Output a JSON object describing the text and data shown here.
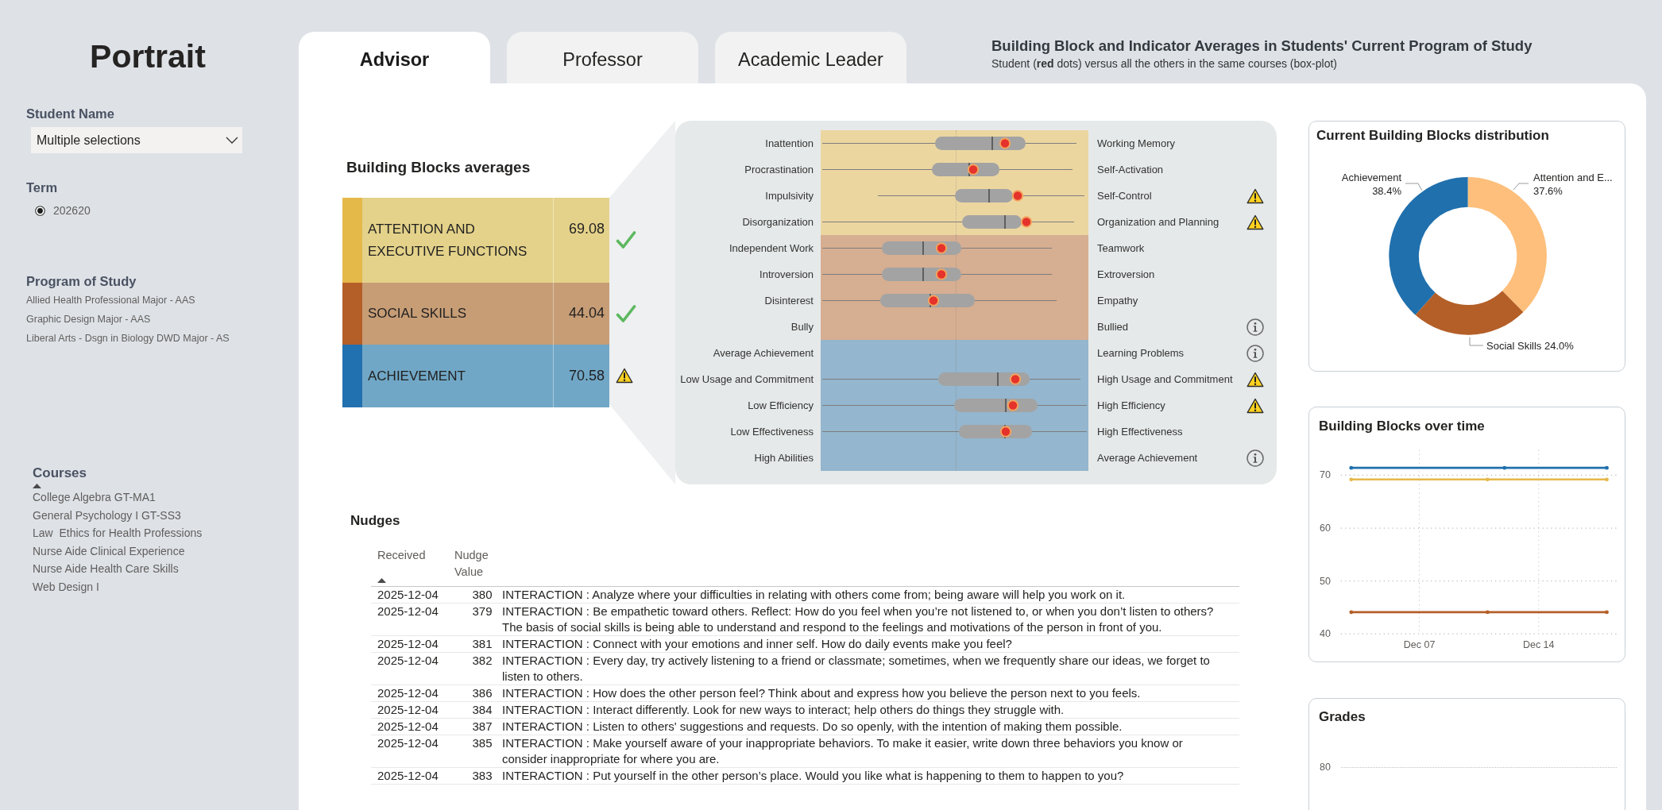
{
  "sidebar": {
    "title": "Portrait",
    "student_name": {
      "label": "Student Name",
      "value": "Multiple selections"
    },
    "term": {
      "label": "Term",
      "options": [
        {
          "label": "202620",
          "selected": true
        }
      ]
    },
    "program_of_study": {
      "label": "Program of Study",
      "items": [
        "Allied Health Professional Major - AAS",
        "Graphic Design Major - AAS",
        "Liberal Arts - Dsgn in Biology DWD Major - AS"
      ]
    },
    "courses": {
      "label": "Courses",
      "sorted": true,
      "items": [
        "College Algebra GT-MA1",
        "General Psychology I GT-SS3",
        "Law  Ethics for Health Professions",
        "Nurse Aide Clinical Experience",
        "Nurse Aide Health Care Skills",
        "Web Design I"
      ]
    }
  },
  "tabs": [
    {
      "label": "Advisor",
      "selected": true
    },
    {
      "label": "Professor",
      "selected": false
    },
    {
      "label": "Academic Leader",
      "selected": false
    }
  ],
  "header": {
    "title": "Building Block and Indicator Averages in Students' Current Program of Study",
    "subtitle": "Student (**red** dots) versus all the others in the same courses (box-plot)"
  },
  "building_blocks": {
    "title": "Building Blocks averages",
    "rows": [
      {
        "name": "ATTENTION AND EXECUTIVE FUNCTIONS",
        "value": "69.08",
        "color": "#e5b84a",
        "kind": "ok"
      },
      {
        "name": "SOCIAL SKILLS",
        "value": "44.04",
        "color": "#b45f28",
        "kind": "ok"
      },
      {
        "name": "ACHIEVEMENT",
        "value": "70.58",
        "color": "#2170b0",
        "kind": "warning"
      }
    ]
  },
  "indicators": {
    "groups": [
      {
        "rows": [
          {
            "left": "Inattention",
            "right": "Working Memory",
            "kind": "plain"
          },
          {
            "left": "Procrastination",
            "right": "Self-Activation",
            "kind": "plain"
          },
          {
            "left": "Impulsivity",
            "right": "Self-Control",
            "kind": "warning"
          },
          {
            "left": "Disorganization",
            "right": "Organization and Planning",
            "kind": "warning"
          }
        ]
      },
      {
        "rows": [
          {
            "left": "Independent Work",
            "right": "Teamwork",
            "kind": "plain"
          },
          {
            "left": "Introversion",
            "right": "Extroversion",
            "kind": "plain"
          },
          {
            "left": "Disinterest",
            "right": "Empathy",
            "kind": "plain"
          },
          {
            "left": "Bully",
            "right": "Bullied",
            "kind": "info"
          }
        ]
      },
      {
        "rows": [
          {
            "left": "Average Achievement",
            "right": "Learning Problems",
            "kind": "info"
          },
          {
            "left": "Low Usage and Commitment",
            "right": "High Usage and Commitment",
            "kind": "warning"
          },
          {
            "left": "Low Efficiency",
            "right": "High Efficiency",
            "kind": "warning"
          },
          {
            "left": "Low Effectiveness",
            "right": "High Effectiveness",
            "kind": "plain"
          },
          {
            "left": "High Abilities",
            "right": "Average Achievement",
            "kind": "info"
          }
        ]
      }
    ]
  },
  "distribution": {
    "chart_data": {
      "type": "donut",
      "title": "Current Building Blocks distribution",
      "categories": [
        "Attention and E...",
        "Social Skills",
        "Achievement"
      ],
      "values": [
        37.6,
        24.0,
        38.4
      ],
      "colors": [
        "#fdbf7b",
        "#b45f28",
        "#2070ad"
      ],
      "value_labels": [
        "37.6%",
        "24.0%",
        "38.4%"
      ]
    }
  },
  "over_time": {
    "chart_data": {
      "type": "line",
      "title": "Building Blocks over time",
      "grid": true,
      "categories": [
        null,
        null,
        null,
        null,
        "Dec 07",
        null,
        null,
        null,
        null,
        null,
        null,
        "Dec 14",
        null,
        null,
        null,
        null
      ],
      "ylim": [
        40,
        74.8
      ],
      "yticks": [
        40,
        50,
        60,
        70
      ],
      "series": [
        {
          "color": "#2070ad",
          "values": [
            71.4,
            null,
            null,
            null,
            null,
            null,
            null,
            null,
            null,
            71.4,
            null,
            null,
            null,
            null,
            null,
            71.4
          ]
        },
        {
          "color": "#e5b84a",
          "values": [
            69.2,
            null,
            null,
            null,
            null,
            null,
            null,
            null,
            69.2,
            null,
            null,
            null,
            null,
            null,
            null,
            69.2
          ]
        },
        {
          "color": "#b45f28",
          "values": [
            44.1,
            null,
            null,
            null,
            null,
            null,
            null,
            null,
            44.1,
            null,
            null,
            null,
            null,
            null,
            null,
            44.1
          ]
        }
      ]
    }
  },
  "grades": {
    "title": "Grades",
    "y_ticks": [
      "80"
    ]
  },
  "nudges": {
    "title": "Nudges",
    "columns": [
      {
        "label": "Received",
        "sorted": true
      },
      {
        "label": "Nudge Value",
        "sorted": false
      }
    ],
    "rows": [
      {
        "received": "2025-12-04",
        "nudge_value": "380",
        "column_3": "INTERACTION : Analyze where your difficulties in relating with others come from; being aware will help you work on it."
      },
      {
        "received": "2025-12-04",
        "nudge_value": "379",
        "column_3": "INTERACTION : Be empathetic toward others. Reflect: How do you feel when you’re not listened to, or when you don’t listen to others? The basis of social skills is being able to understand and respond to the feelings and motivations of the person in front of you."
      },
      {
        "received": "2025-12-04",
        "nudge_value": "381",
        "column_3": "INTERACTION : Connect with your emotions and inner self. How do daily events make you feel?"
      },
      {
        "received": "2025-12-04",
        "nudge_value": "382",
        "column_3": "INTERACTION : Every day, try actively listening to a friend or classmate; sometimes, when we frequently share our ideas, we forget to listen to others."
      },
      {
        "received": "2025-12-04",
        "nudge_value": "386",
        "column_3": "INTERACTION : How does the other person feel? Think about and express how you believe the person next to you feels."
      },
      {
        "received": "2025-12-04",
        "nudge_value": "384",
        "column_3": "INTERACTION : Interact differently. Look for new ways to interact; help others do things they struggle with."
      },
      {
        "received": "2025-12-04",
        "nudge_value": "387",
        "column_3": "INTERACTION : Listen to others' suggestions and requests. Do so openly, with the intention of making them possible."
      },
      {
        "received": "2025-12-04",
        "nudge_value": "385",
        "column_3": "INTERACTION : Make yourself aware of your inappropriate behaviors. To make it easier, write down three behaviors you know or consider inappropriate for where you are."
      },
      {
        "received": "2025-12-04",
        "nudge_value": "383",
        "column_3": "INTERACTION : Put yourself in the other person’s place. Would you like what is happening to them to happen to you?"
      }
    ]
  }
}
